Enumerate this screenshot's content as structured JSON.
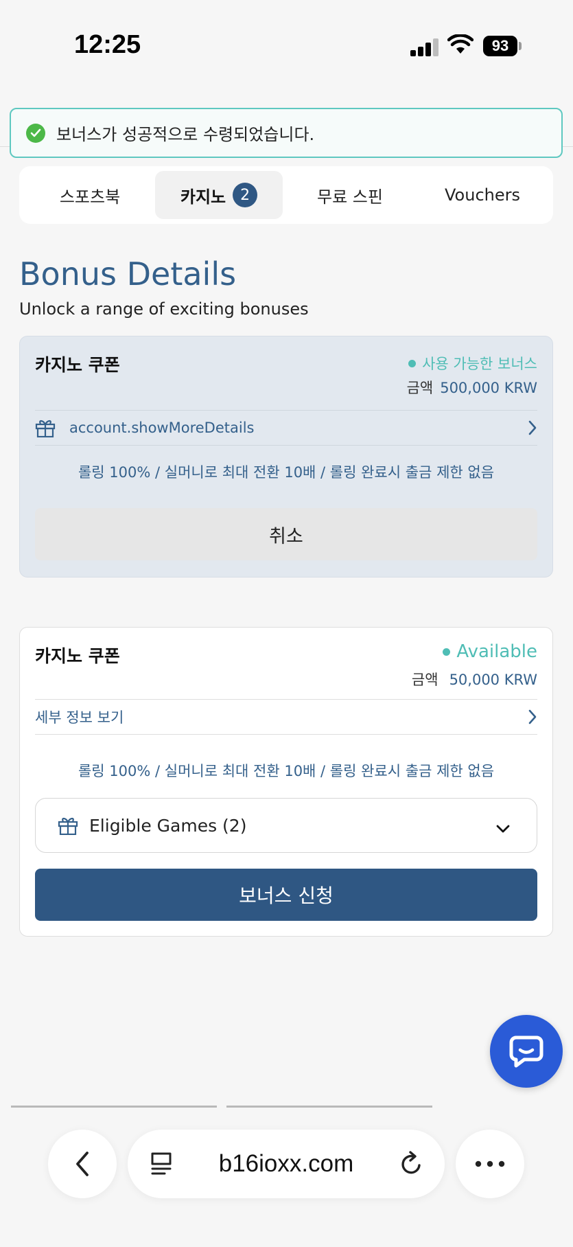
{
  "status_bar": {
    "time": "12:25",
    "battery": "93"
  },
  "toast": {
    "message": "보너스가 성공적으로 수령되었습니다."
  },
  "tabs": [
    {
      "label": "스포츠북"
    },
    {
      "label": "카지노",
      "badge": "2"
    },
    {
      "label": "무료 스핀"
    },
    {
      "label": "Vouchers"
    }
  ],
  "header": {
    "title": "Bonus Details",
    "subtitle": "Unlock a range of exciting bonuses"
  },
  "bonus_cards": [
    {
      "title": "카지노 쿠폰",
      "status": "사용 가능한 보너스",
      "amount_label": "금액",
      "amount_value": "500,000 KRW",
      "details_link": "account.showMoreDetails",
      "rules": "롤링 100% / 실머니로 최대 전환 10배 / 롤링 완료시 출금 제한 없음",
      "action_label": "취소"
    },
    {
      "title": "카지노 쿠폰",
      "status": "Available",
      "amount_label": "금액",
      "amount_value": "50,000 KRW",
      "details_link": "세부 정보 보기",
      "rules": "롤링 100% / 실머니로 최대 전환 10배 / 롤링 완료시 출금 제한 없음",
      "eligible_games": "Eligible Games (2)",
      "action_label": "보너스 신청"
    }
  ],
  "browser": {
    "url": "b16ioxx.com"
  },
  "colors": {
    "accent": "#2f5783",
    "available": "#4fbdb5",
    "chat": "#2a5bd7",
    "success": "#4cb848"
  }
}
